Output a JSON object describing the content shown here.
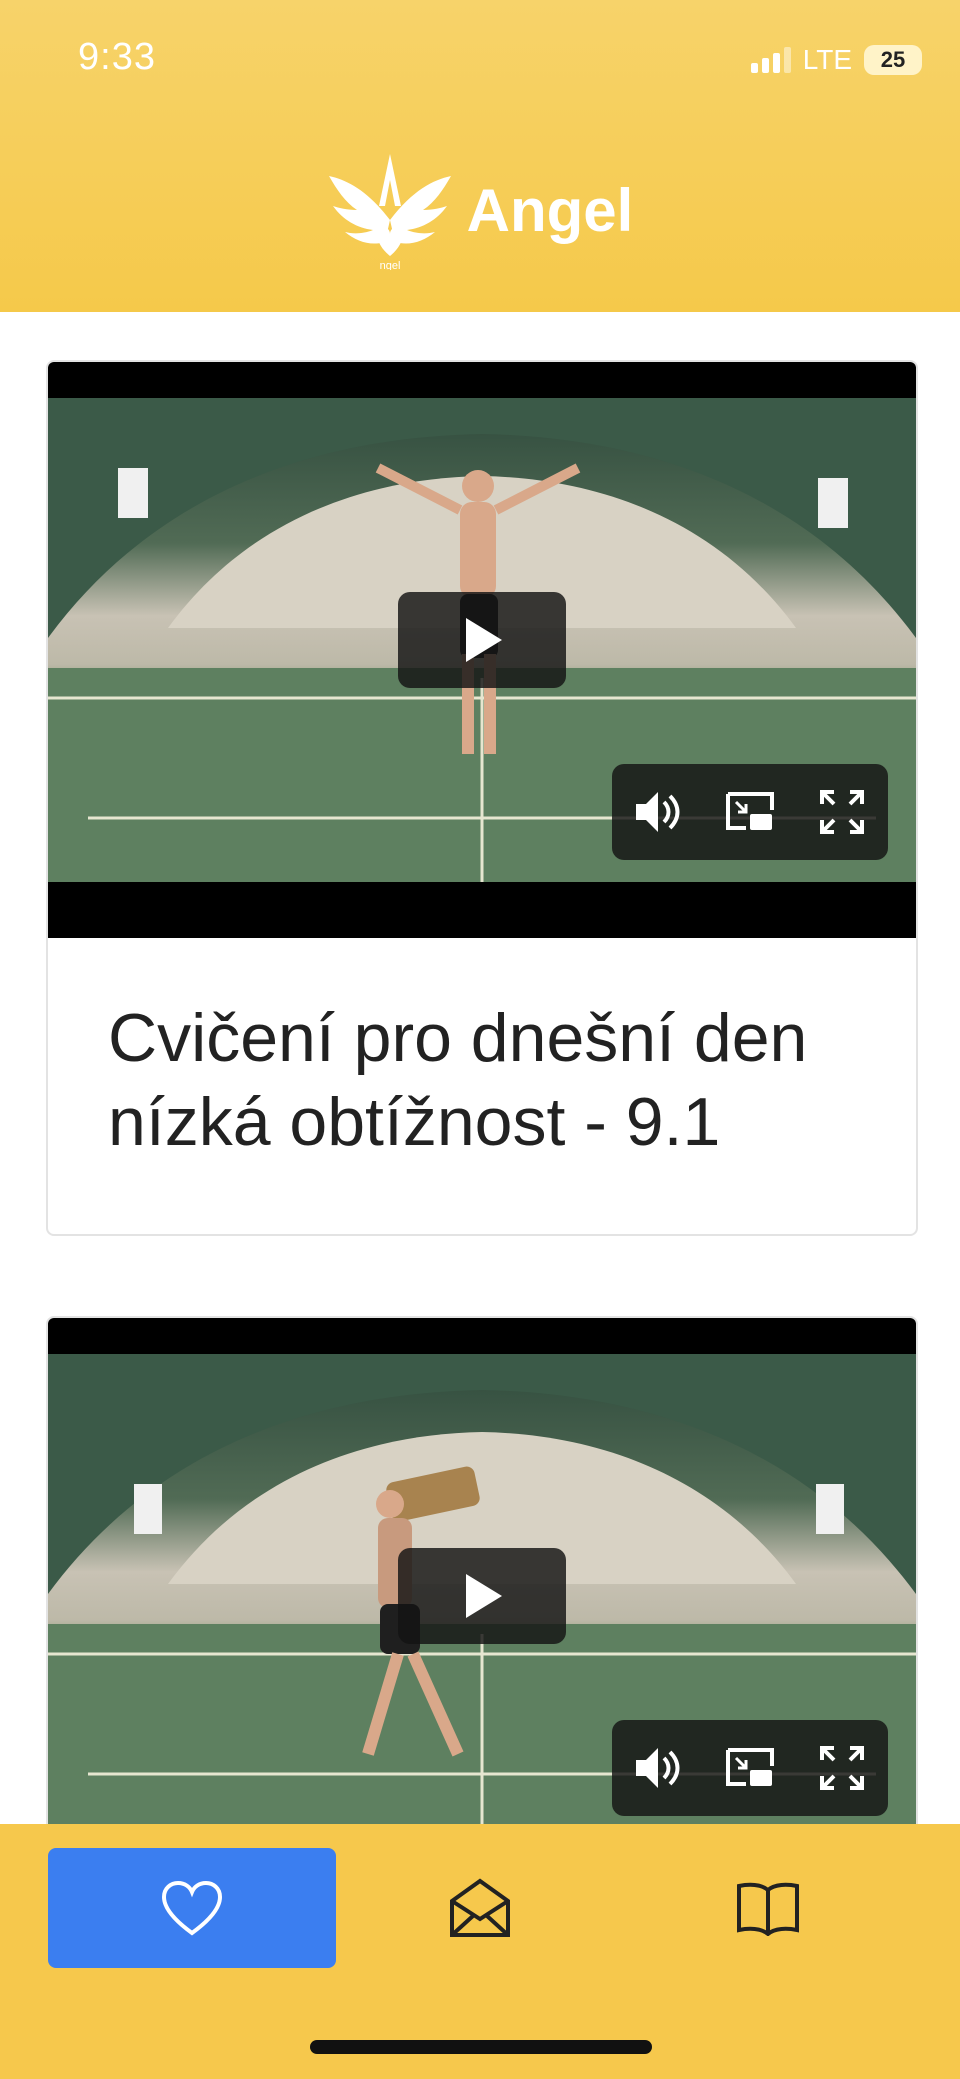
{
  "status_bar": {
    "time": "9:33",
    "network": "LTE",
    "battery": "25"
  },
  "app": {
    "name": "Angel",
    "logo_caption": "ngel"
  },
  "videos": [
    {
      "title": "Cvičení pro dnešní den nízká obtížnost - 9.1"
    },
    {
      "title": ""
    }
  ],
  "video_controls": {
    "play_icon": "play-icon",
    "volume_icon": "volume-icon",
    "pip_icon": "picture-in-picture-icon",
    "fullscreen_icon": "fullscreen-icon"
  },
  "tabbar": {
    "items": [
      {
        "icon": "heart-icon",
        "active": true
      },
      {
        "icon": "envelope-open-icon",
        "active": false
      },
      {
        "icon": "book-icon",
        "active": false
      }
    ]
  },
  "colors": {
    "header": "#f5c94a",
    "tabbar": "#f6c84c",
    "active_tab": "#3b7ef0"
  }
}
